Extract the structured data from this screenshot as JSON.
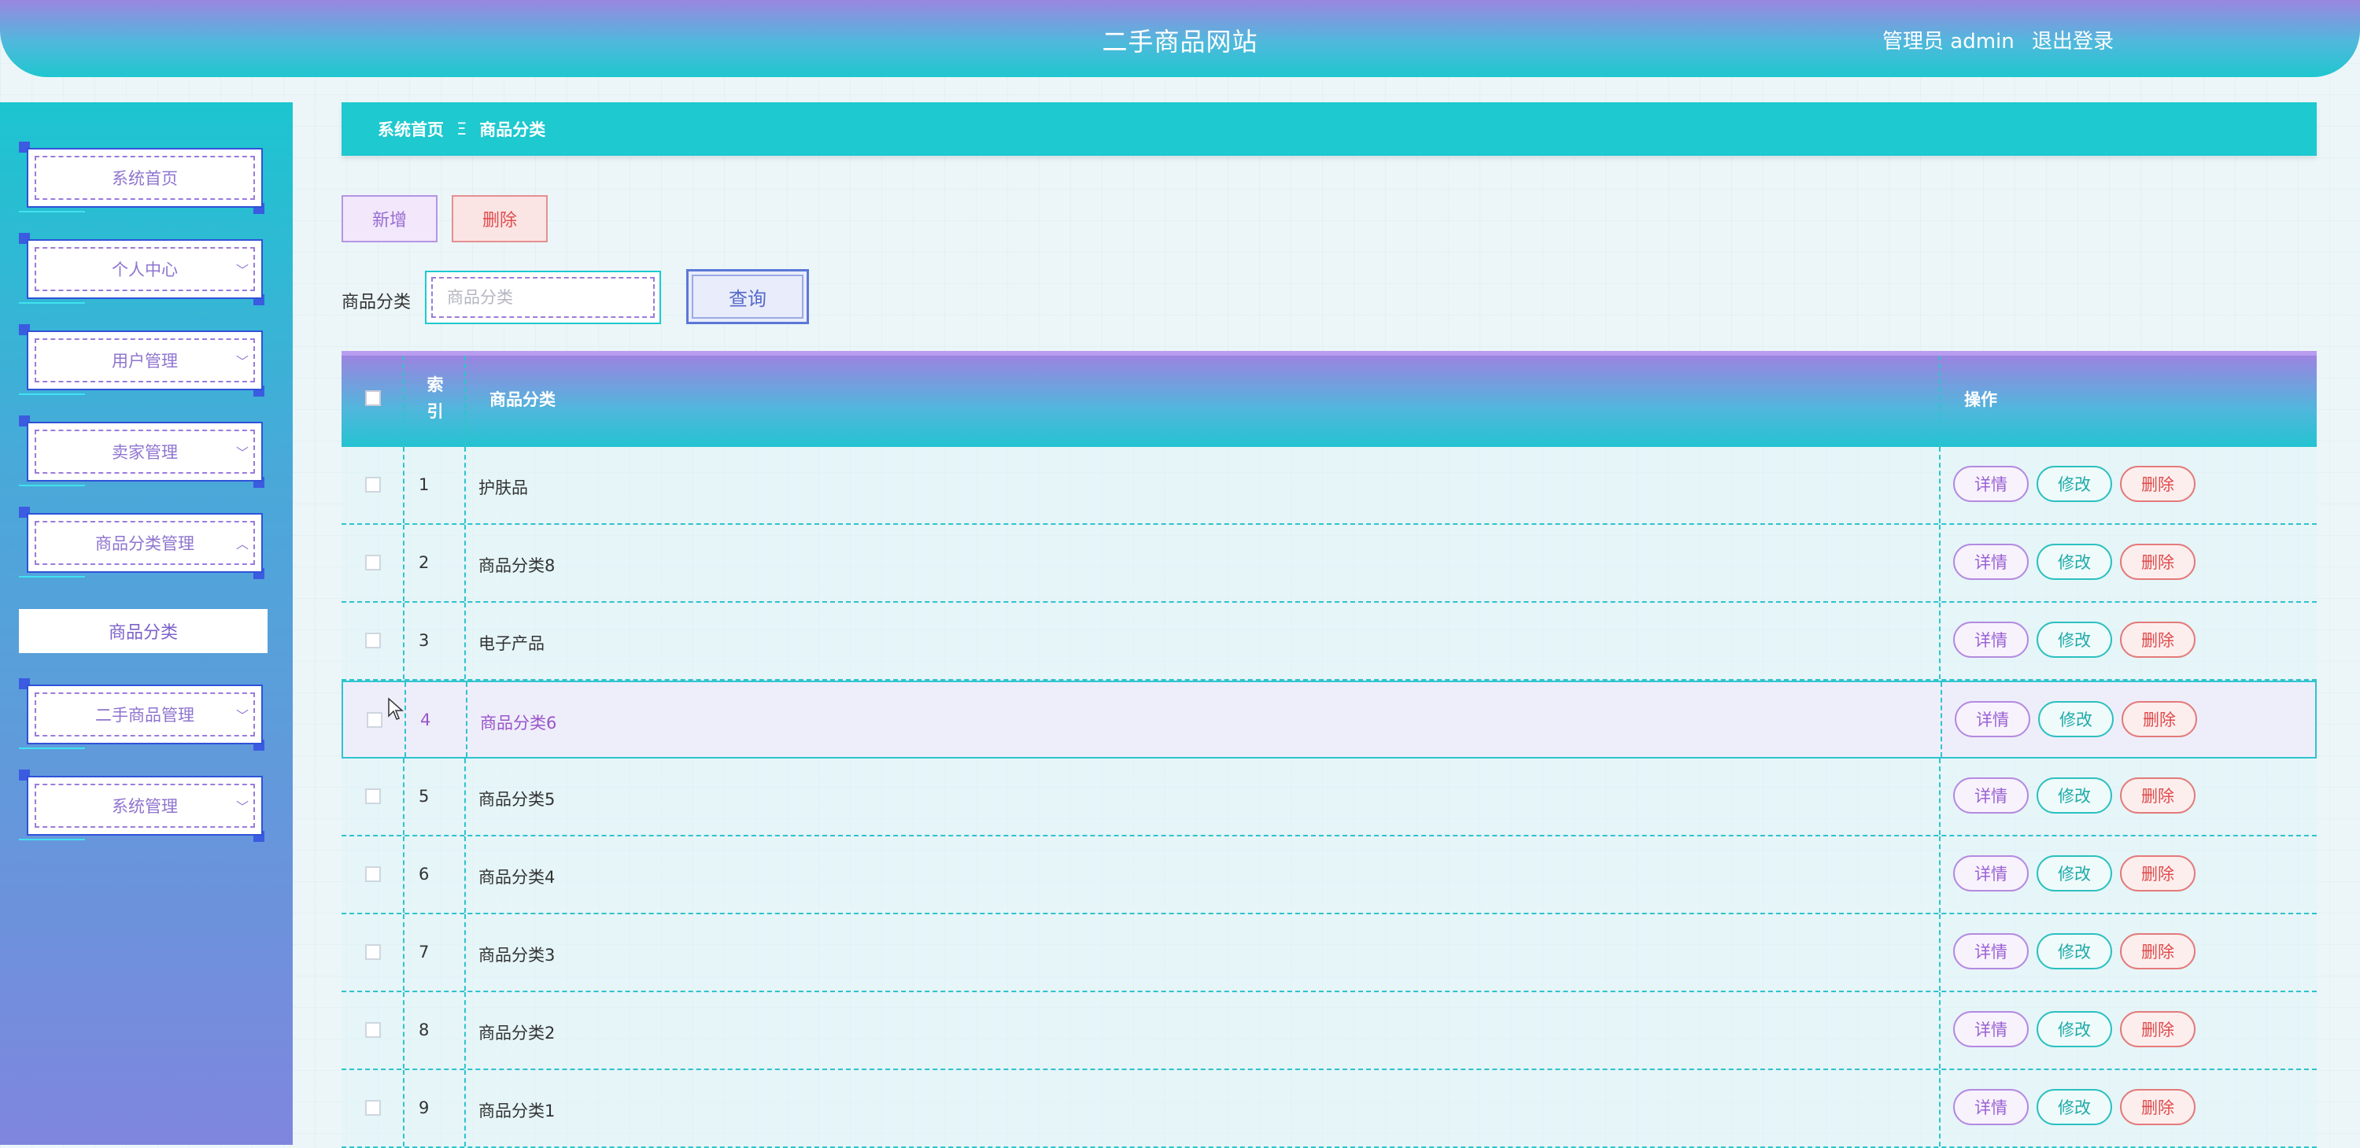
{
  "header": {
    "title": "二手商品网站",
    "user_label": "管理员 admin",
    "logout_label": "退出登录"
  },
  "sidebar": {
    "items": [
      {
        "label": "系统首页",
        "has_arrow": false
      },
      {
        "label": "个人中心",
        "has_arrow": true,
        "arrow": "chevron-down"
      },
      {
        "label": "用户管理",
        "has_arrow": true,
        "arrow": "chevron-down"
      },
      {
        "label": "卖家管理",
        "has_arrow": true,
        "arrow": "chevron-down"
      },
      {
        "label": "商品分类管理",
        "has_arrow": true,
        "arrow": "chevron-up"
      },
      {
        "label": "二手商品管理",
        "has_arrow": true,
        "arrow": "chevron-down"
      },
      {
        "label": "系统管理",
        "has_arrow": true,
        "arrow": "chevron-down"
      }
    ],
    "submenu": {
      "label": "商品分类"
    }
  },
  "breadcrumb": {
    "home": "系统首页",
    "separator": "Ξ",
    "current": "商品分类"
  },
  "actions": {
    "add_label": "新增",
    "delete_label": "删除"
  },
  "search": {
    "label": "商品分类",
    "placeholder": "商品分类",
    "value": "",
    "button_label": "查询"
  },
  "table": {
    "columns": {
      "index": "索\n引",
      "name": "商品分类",
      "ops": "操作"
    },
    "rows": [
      {
        "index": "1",
        "name": "护肤品"
      },
      {
        "index": "2",
        "name": "商品分类8"
      },
      {
        "index": "3",
        "name": "电子产品"
      },
      {
        "index": "4",
        "name": "商品分类6"
      },
      {
        "index": "5",
        "name": "商品分类5"
      },
      {
        "index": "6",
        "name": "商品分类4"
      },
      {
        "index": "7",
        "name": "商品分类3"
      },
      {
        "index": "8",
        "name": "商品分类2"
      },
      {
        "index": "9",
        "name": "商品分类1"
      }
    ],
    "hovered_row": 3,
    "row_actions": {
      "detail": "详情",
      "edit": "修改",
      "delete": "删除"
    }
  },
  "colors": {
    "accent_cyan": "#1ec9cf",
    "accent_purple": "#9b84e0",
    "danger": "#df4b4b"
  }
}
